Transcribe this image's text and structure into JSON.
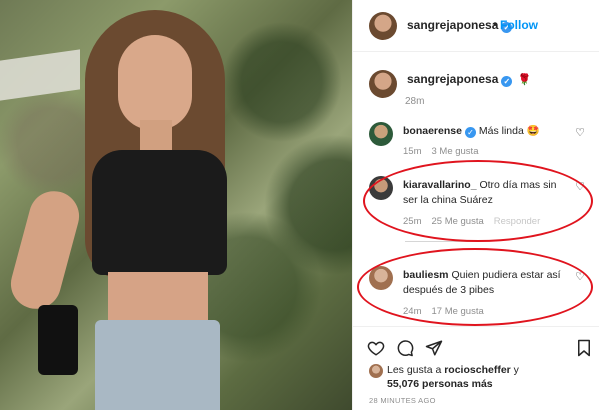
{
  "post": {
    "username": "sangrejaponesa",
    "separator": "•",
    "follow_label": "Follow",
    "verified_mark": "✓"
  },
  "caption": {
    "username": "sangrejaponesa",
    "emoji": "🌹",
    "time": "28m"
  },
  "comments": [
    {
      "username": "bonaerense",
      "verified": true,
      "text": "Más linda 🤩",
      "time": "15m",
      "likes": "3 Me gusta",
      "reply": ""
    },
    {
      "username": "kiaravallarino_",
      "verified": false,
      "text": "Otro día mas sin ser la china Suárez",
      "time": "25m",
      "likes": "25 Me gusta",
      "reply": "Responder"
    },
    {
      "username": "bauliesm",
      "verified": false,
      "text": "Quien pudiera estar así después de 3 pibes",
      "time": "24m",
      "likes": "17 Me gusta",
      "reply": ""
    }
  ],
  "likes": {
    "prefix": "Les gusta a",
    "user": "rocioscheffer",
    "suffix": "y",
    "count": "55,076 personas más"
  },
  "timestamp": "28 MINUTES AGO",
  "icons": [
    "heart-icon",
    "comment-icon",
    "share-icon",
    "save-icon"
  ],
  "colors": {
    "accent": "#0095f6",
    "verified": "#3897f0",
    "annotation": "#e0141e",
    "muted": "#8e8e8e"
  }
}
